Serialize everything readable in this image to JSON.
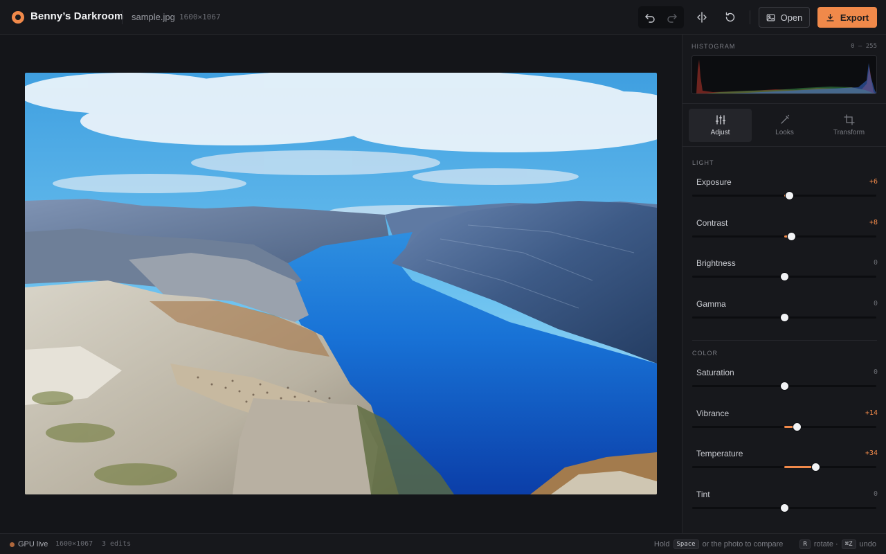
{
  "app": {
    "title": "Benny’s Darkroom",
    "file_name": "sample.jpg",
    "file_dims": "1600×1067"
  },
  "toolbar": {
    "undo_icon": "undo-arrow-icon",
    "redo_icon": "redo-arrow-icon",
    "compare_icon": "split-compare-icon",
    "reset_icon": "reset-rotate-icon",
    "open_label": "Open",
    "export_label": "Export"
  },
  "histogram": {
    "label": "HISTOGRAM",
    "range": "0 – 255"
  },
  "tabs": [
    {
      "label": "Adjust",
      "icon": "sliders-icon",
      "active": true
    },
    {
      "label": "Looks",
      "icon": "wand-icon",
      "active": false
    },
    {
      "label": "Transform",
      "icon": "crop-icon",
      "active": false
    }
  ],
  "sections": {
    "light": {
      "label": "LIGHT",
      "sliders": [
        {
          "name": "Exposure",
          "value": "+6",
          "level": 6
        },
        {
          "name": "Contrast",
          "value": "+8",
          "level": 8
        },
        {
          "name": "Brightness",
          "value": "0",
          "level": 0
        },
        {
          "name": "Gamma",
          "value": "0",
          "level": 0
        }
      ]
    },
    "color": {
      "label": "COLOR",
      "sliders": [
        {
          "name": "Saturation",
          "value": "0",
          "level": 0
        },
        {
          "name": "Vibrance",
          "value": "+14",
          "level": 14
        },
        {
          "name": "Temperature",
          "value": "+34",
          "level": 34
        },
        {
          "name": "Tint",
          "value": "0",
          "level": 0
        }
      ]
    }
  },
  "status": {
    "gpu": "GPU live",
    "dims": "1600×1067",
    "edits": "3 edits",
    "hint_hold": "Hold",
    "key_space": "Space",
    "hint_compare": "or the photo to compare",
    "key_r": "R",
    "hint_rotate": "rotate ·",
    "key_undo": "⌘Z",
    "hint_undo": "undo"
  },
  "colors": {
    "accent": "#f0894a",
    "background": "#131418",
    "panel": "#17181c"
  }
}
